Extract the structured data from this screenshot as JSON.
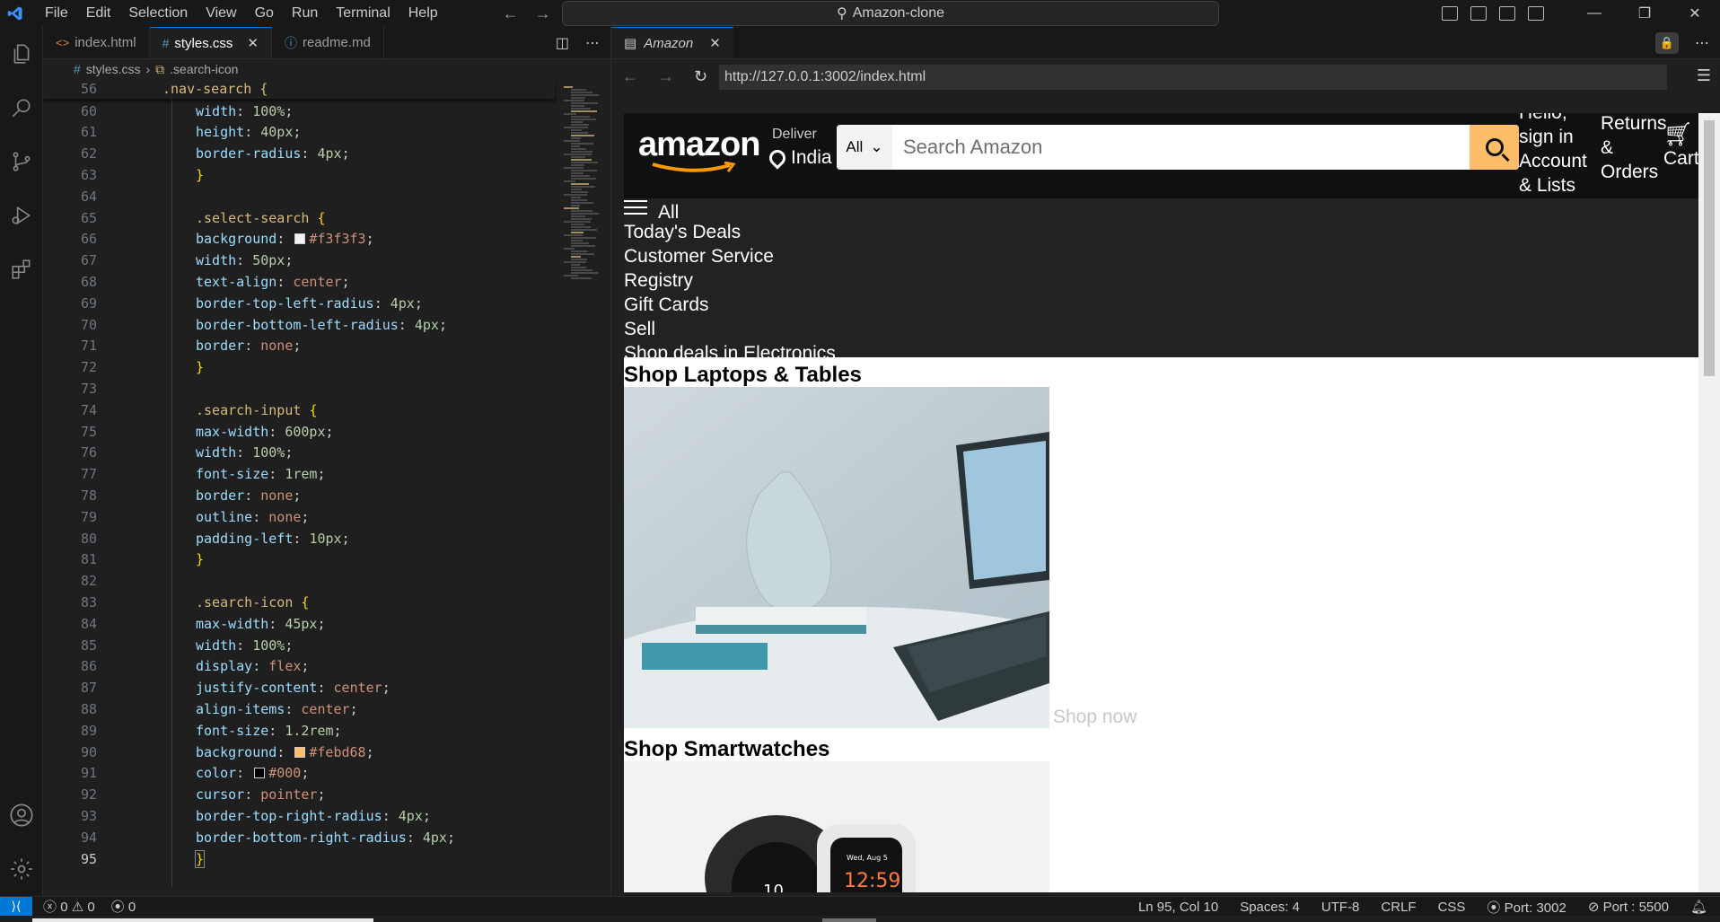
{
  "menu": [
    "File",
    "Edit",
    "Selection",
    "View",
    "Go",
    "Run",
    "Terminal",
    "Help"
  ],
  "command_center": "Amazon-clone",
  "editor": {
    "tabs": [
      {
        "label": "index.html",
        "icon": "html-icon"
      },
      {
        "label": "styles.css",
        "icon": "css-icon",
        "active": true
      },
      {
        "label": "readme.md",
        "icon": "info-icon"
      }
    ],
    "breadcrumb": {
      "file": "styles.css",
      "symbol": ".search-icon"
    },
    "sticky": {
      "ln": "56",
      "text": ".nav-search {"
    },
    "lines": [
      {
        "ln": "60",
        "prop": "width",
        "val": "100%",
        "kind": "num"
      },
      {
        "ln": "61",
        "prop": "height",
        "val": "40px",
        "kind": "num"
      },
      {
        "ln": "62",
        "prop": "border-radius",
        "val": "4px",
        "kind": "num"
      },
      {
        "ln": "63",
        "close": true
      },
      {
        "ln": "64"
      },
      {
        "ln": "65",
        "selector": ".select-search"
      },
      {
        "ln": "66",
        "prop": "background",
        "val": "#f3f3f3",
        "kind": "val",
        "swatch": "#f3f3f3"
      },
      {
        "ln": "67",
        "prop": "width",
        "val": "50px",
        "kind": "num"
      },
      {
        "ln": "68",
        "prop": "text-align",
        "val": "center",
        "kind": "val"
      },
      {
        "ln": "69",
        "prop": "border-top-left-radius",
        "val": "4px",
        "kind": "num"
      },
      {
        "ln": "70",
        "prop": "border-bottom-left-radius",
        "val": "4px",
        "kind": "num"
      },
      {
        "ln": "71",
        "prop": "border",
        "val": "none",
        "kind": "val"
      },
      {
        "ln": "72",
        "close": true
      },
      {
        "ln": "73"
      },
      {
        "ln": "74",
        "selector": ".search-input"
      },
      {
        "ln": "75",
        "prop": "max-width",
        "val": "600px",
        "kind": "num"
      },
      {
        "ln": "76",
        "prop": "width",
        "val": "100%",
        "kind": "num"
      },
      {
        "ln": "77",
        "prop": "font-size",
        "val": "1rem",
        "kind": "num"
      },
      {
        "ln": "78",
        "prop": "border",
        "val": "none",
        "kind": "val"
      },
      {
        "ln": "79",
        "prop": "outline",
        "val": "none",
        "kind": "val"
      },
      {
        "ln": "80",
        "prop": "padding-left",
        "val": "10px",
        "kind": "num"
      },
      {
        "ln": "81",
        "close": true
      },
      {
        "ln": "82"
      },
      {
        "ln": "83",
        "selector": ".search-icon"
      },
      {
        "ln": "84",
        "prop": "max-width",
        "val": "45px",
        "kind": "num"
      },
      {
        "ln": "85",
        "prop": "width",
        "val": "100%",
        "kind": "num"
      },
      {
        "ln": "86",
        "prop": "display",
        "val": "flex",
        "kind": "val"
      },
      {
        "ln": "87",
        "prop": "justify-content",
        "val": "center",
        "kind": "val"
      },
      {
        "ln": "88",
        "prop": "align-items",
        "val": "center",
        "kind": "val"
      },
      {
        "ln": "89",
        "prop": "font-size",
        "val": "1.2rem",
        "kind": "num"
      },
      {
        "ln": "90",
        "prop": "background",
        "val": "#febd68",
        "kind": "val",
        "swatch": "#febd68"
      },
      {
        "ln": "91",
        "prop": "color",
        "val": "#000",
        "kind": "val",
        "swatch": "#000000"
      },
      {
        "ln": "92",
        "prop": "cursor",
        "val": "pointer",
        "kind": "val"
      },
      {
        "ln": "93",
        "prop": "border-top-right-radius",
        "val": "4px",
        "kind": "num"
      },
      {
        "ln": "94",
        "prop": "border-bottom-right-radius",
        "val": "4px",
        "kind": "num"
      },
      {
        "ln": "95",
        "close": true,
        "current": true
      }
    ]
  },
  "browser": {
    "tab_label": "Amazon",
    "url": "http://127.0.0.1:3002/index.html"
  },
  "amazon": {
    "logo": "amazon",
    "deliver": "Deliver",
    "location": "India",
    "search_select": "All",
    "search_placeholder": "Search Amazon",
    "signin": "Hello, sign in Account & Lists",
    "returns": "Returns & Orders",
    "cart": "Cart",
    "panel_all": "All",
    "panel_items": [
      "Today's Deals",
      "Customer Service",
      "Registry",
      "Gift Cards",
      "Sell",
      "Shop deals in Electronics"
    ],
    "sections": [
      {
        "title": "Shop Laptops & Tables",
        "link": "Shop now"
      },
      {
        "title": "Shop Smartwatches"
      }
    ]
  },
  "status": {
    "errors": "0",
    "warnings": "0",
    "ports": "0",
    "position": "Ln 95, Col 10",
    "spaces": "Spaces: 4",
    "encoding": "UTF-8",
    "eol": "CRLF",
    "language": "CSS",
    "port": "Port: 3002",
    "live_port": "Port : 5500"
  },
  "colors": {
    "accent": "#0078d4",
    "amazon_nav": "#0f1111",
    "amazon_search_btn": "#febd68"
  }
}
